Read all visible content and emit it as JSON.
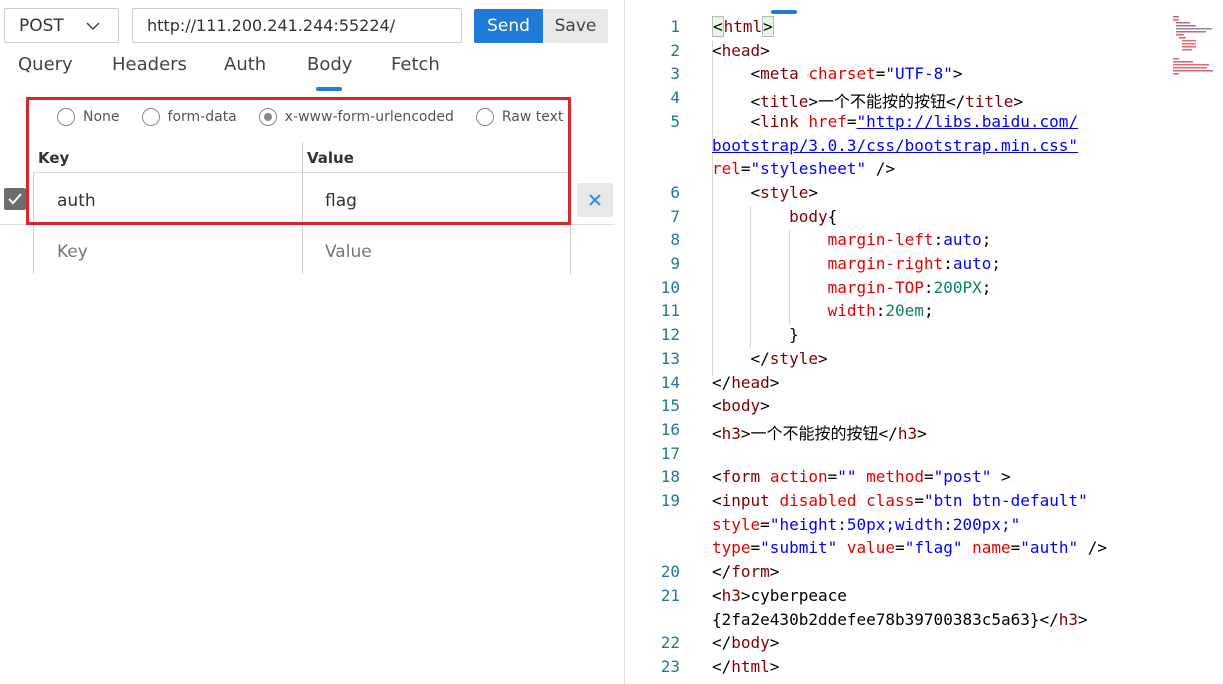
{
  "request": {
    "method": "POST",
    "url": "http://111.200.241.244:55224/",
    "send_label": "Send",
    "save_label": "Save"
  },
  "tabs": [
    {
      "label": "Query"
    },
    {
      "label": "Headers"
    },
    {
      "label": "Auth"
    },
    {
      "label": "Body",
      "active": true
    },
    {
      "label": "Fetch"
    }
  ],
  "body": {
    "radio_options": [
      {
        "label": "None",
        "checked": false
      },
      {
        "label": "form-data",
        "checked": false
      },
      {
        "label": "x-www-form-urlencoded",
        "checked": true
      },
      {
        "label": "Raw text",
        "checked": false
      }
    ],
    "table": {
      "key_header": "Key",
      "value_header": "Value",
      "rows": [
        {
          "enabled": true,
          "key": "auth",
          "value": "flag"
        }
      ],
      "new_row": {
        "key_placeholder": "Key",
        "value_placeholder": "Value"
      }
    }
  },
  "code": {
    "line_numbers": [
      "1",
      "2",
      "3",
      "4",
      "5",
      "",
      "",
      "6",
      "7",
      "8",
      "9",
      "10",
      "11",
      "12",
      "13",
      "14",
      "15",
      "16",
      "17",
      "18",
      "19",
      "",
      "",
      "20",
      "21",
      "",
      "22",
      "23"
    ],
    "text": {
      "title_cn": "一个不能按的按钮",
      "h3_cn": "一个不能按的按钮",
      "link_url_1": "http://libs.baidu.com/",
      "link_url_2": "bootstrap/3.0.3/css/bootstrap.min.css",
      "flag_line_1": "cyberpeace",
      "flag_line_2": "{2fa2e430b2ddefee78b39700383c5a63}"
    }
  },
  "colors": {
    "accent": "#1f7ad8",
    "highlight_border": "#d9262c",
    "tag": "#800000",
    "attribute": "#e50000",
    "string": "#0000ff",
    "number": "#098658",
    "line_number": "#237893"
  }
}
